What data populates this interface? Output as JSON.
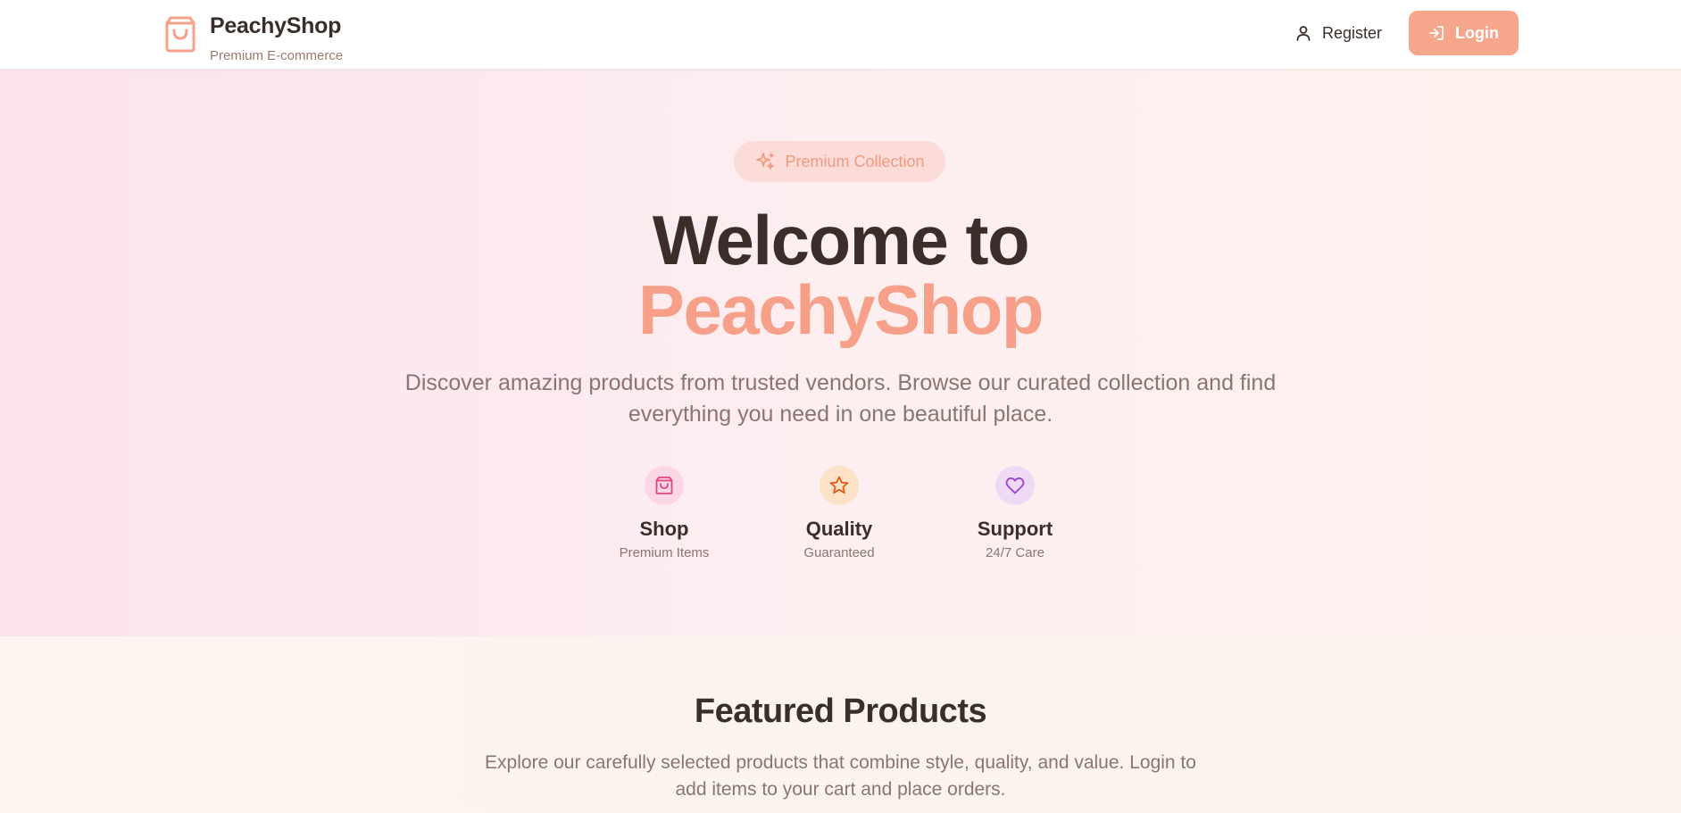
{
  "header": {
    "brand_name": "PeachyShop",
    "brand_tagline": "Premium E-commerce",
    "register_label": "Register",
    "login_label": "Login"
  },
  "hero": {
    "badge": "Premium Collection",
    "title_line1": "Welcome to",
    "title_line2": "PeachyShop",
    "subtitle": "Discover amazing products from trusted vendors. Browse our curated collection and find everything you need in one beautiful place.",
    "features": [
      {
        "title": "Shop",
        "subtitle": "Premium Items",
        "icon": "shopping-bag-icon",
        "color": "#e0457b"
      },
      {
        "title": "Quality",
        "subtitle": "Guaranteed",
        "icon": "star-icon",
        "color": "#e8591a"
      },
      {
        "title": "Support",
        "subtitle": "24/7 Care",
        "icon": "heart-icon",
        "color": "#9b3fd6"
      }
    ]
  },
  "featured": {
    "title": "Featured Products",
    "subtitle": "Explore our carefully selected products that combine style, quality, and value. Login to add items to your cart and place orders."
  },
  "colors": {
    "accent": "#f6a68a",
    "text_dark": "#3a2e2a",
    "text_muted": "#8a7670"
  }
}
